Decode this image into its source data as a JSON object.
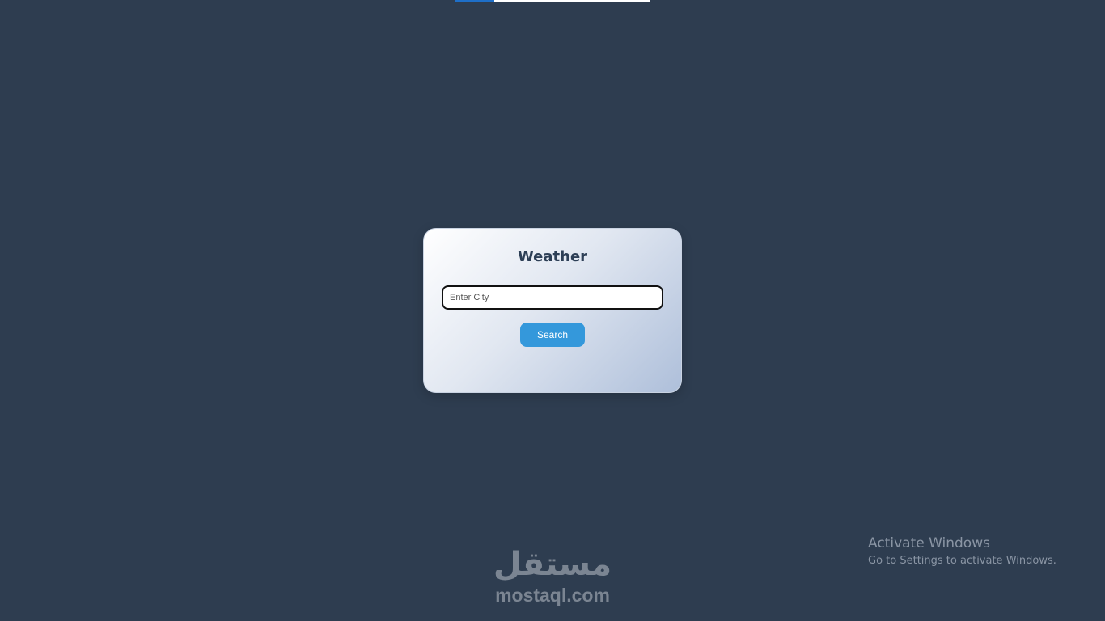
{
  "page": {
    "background_color": "#2e3d50",
    "loading_bar_progress": 0.2
  },
  "weather_card": {
    "title": "Weather",
    "city_input": {
      "value": "",
      "placeholder": "Enter City"
    },
    "search_button_label": "Search",
    "button_color": "#3498db",
    "title_color": "#2d3f56"
  },
  "watermark": {
    "arabic_text": "مستقل",
    "latin_text": "mostaql.com"
  },
  "os_notice": {
    "title": "Activate Windows",
    "subtitle": "Go to Settings to activate Windows."
  }
}
